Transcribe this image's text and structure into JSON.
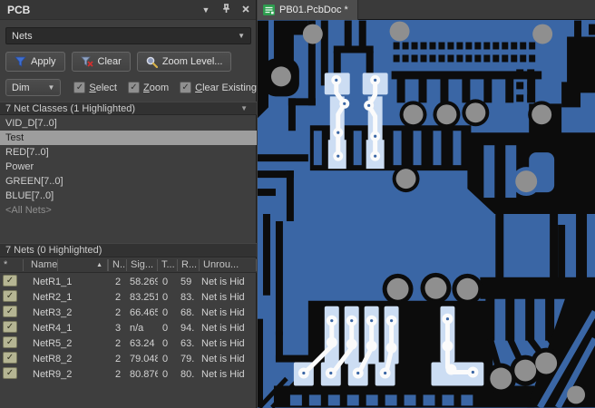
{
  "glyphs": {
    "check": "✓",
    "dropdown_arrow": "▼",
    "sort_asc": "▲"
  },
  "panel": {
    "title": "PCB",
    "mode_dropdown": {
      "value": "Nets"
    },
    "toolbar": {
      "apply_label": "Apply",
      "clear_label": "Clear",
      "zoom_level_label": "Zoom Level..."
    },
    "dim_row": {
      "dropdown_value": "Dim",
      "checkboxes": [
        {
          "label": "Select",
          "checked": true
        },
        {
          "label": "Zoom",
          "checked": true
        },
        {
          "label": "Clear Existing",
          "checked": true
        }
      ]
    },
    "net_classes": {
      "header": "7 Net Classes (1 Highlighted)",
      "items": [
        {
          "label": "VID_D[7..0]",
          "state": "normal"
        },
        {
          "label": "Test",
          "state": "selected"
        },
        {
          "label": "RED[7..0]",
          "state": "normal"
        },
        {
          "label": "Power",
          "state": "normal"
        },
        {
          "label": "GREEN[7..0]",
          "state": "normal"
        },
        {
          "label": "BLUE[7..0]",
          "state": "normal"
        },
        {
          "label": "<All Nets>",
          "state": "dim"
        }
      ]
    },
    "nets": {
      "header": "7 Nets (0 Highlighted)",
      "columns": {
        "check": "*",
        "name": "Name",
        "nodes": "N..",
        "signal": "Sig...",
        "t": "T...",
        "routed": "R...",
        "unrouted": "Unrou..."
      },
      "rows": [
        {
          "checked": true,
          "name": "NetR1_1",
          "nodes": "2",
          "signal": "58.269",
          "t": "0",
          "routed": "59",
          "unrouted": "Net is Hid"
        },
        {
          "checked": true,
          "name": "NetR2_1",
          "nodes": "2",
          "signal": "83.251",
          "t": "0",
          "routed": "83.",
          "unrouted": "Net is Hid"
        },
        {
          "checked": true,
          "name": "NetR3_2",
          "nodes": "2",
          "signal": "66.465",
          "t": "0",
          "routed": "68.",
          "unrouted": "Net is Hid"
        },
        {
          "checked": true,
          "name": "NetR4_1",
          "nodes": "3",
          "signal": "n/a",
          "t": "0",
          "routed": "94.",
          "unrouted": "Net is Hid"
        },
        {
          "checked": true,
          "name": "NetR5_2",
          "nodes": "2",
          "signal": "63.24",
          "t": "0",
          "routed": "63.",
          "unrouted": "Net is Hid"
        },
        {
          "checked": true,
          "name": "NetR8_2",
          "nodes": "2",
          "signal": "79.048",
          "t": "0",
          "routed": "79.",
          "unrouted": "Net is Hid"
        },
        {
          "checked": true,
          "name": "NetR9_2",
          "nodes": "2",
          "signal": "80.876",
          "t": "0",
          "routed": "80.",
          "unrouted": "Net is Hid"
        }
      ]
    }
  },
  "editor": {
    "tab_label": "PB01.PcbDoc *"
  },
  "colors": {
    "pcb_copper_blue": "#3a66a5",
    "pcb_background_black": "#0c0c0c",
    "via_gray": "#8f8f8f",
    "highlight_pale": "#ccddf3",
    "highlight_white": "#fbfbfb",
    "selected_item_bg": "#9d9d9d"
  }
}
